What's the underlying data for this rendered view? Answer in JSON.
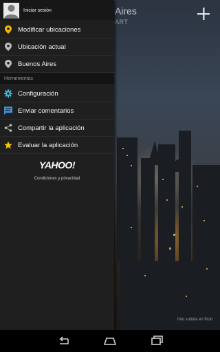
{
  "background": {
    "title": "Aires",
    "subtitle": "ART",
    "photo_credit": "foto subida en flickr"
  },
  "drawer": {
    "profile": {
      "signin_label": "Iniciar sesión"
    },
    "location_items": [
      {
        "label": "Modificar ubicaciones",
        "icon": "location-pin-icon",
        "color": "#f5b800"
      },
      {
        "label": "Ubicación actual",
        "icon": "location-pin-icon",
        "color": "#bdbdbd"
      },
      {
        "label": "Buenos Aires",
        "icon": "location-pin-icon",
        "color": "#bdbdbd"
      }
    ],
    "section_title": "Herramientas",
    "tool_items": [
      {
        "label": "Configuración",
        "icon": "gear-icon",
        "color": "#3fb8d6"
      },
      {
        "label": "Enviar comentarios",
        "icon": "chat-icon",
        "color": "#3d8fd6"
      },
      {
        "label": "Compartir la aplicación",
        "icon": "share-icon",
        "color": "#bdbdbd"
      },
      {
        "label": "Evaluar la aplicación",
        "icon": "star-icon",
        "color": "#f5c400"
      }
    ],
    "brand": "YAHOO!",
    "terms": "Condiciones y privacidad"
  },
  "navbar": {
    "back": "back-icon",
    "home": "home-icon",
    "recents": "recent-apps-icon"
  }
}
